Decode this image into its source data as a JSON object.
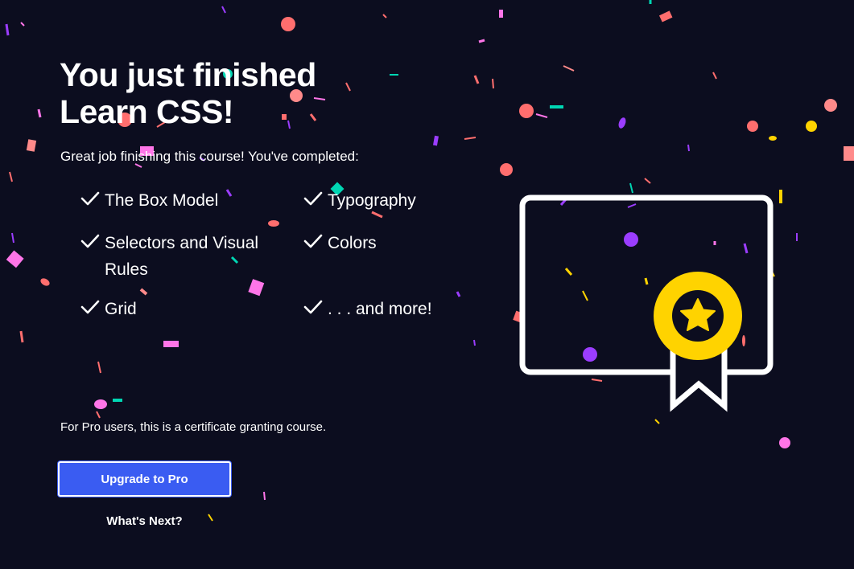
{
  "celebration": {
    "title_line1": "You just finished",
    "title_line2": "Learn CSS!",
    "subtitle": "Great job finishing this course! You've completed:",
    "completed_items": [
      {
        "label": "The Box Model"
      },
      {
        "label": "Typography"
      },
      {
        "label": "Selectors and Visual Rules"
      },
      {
        "label": "Colors"
      },
      {
        "label": "Grid"
      },
      {
        "label": ". . . and more!"
      }
    ],
    "pro_note": "For Pro users, this is a certificate granting course.",
    "upgrade_label": "Upgrade to Pro",
    "next_label": "What's Next?"
  },
  "icons": {
    "check": "check-icon",
    "certificate": "certificate-icon",
    "badge": "star-badge-icon"
  },
  "colors": {
    "background": "#0c0d1f",
    "button": "#3a5cf2",
    "badge": "#ffd300",
    "confetti": [
      "#ff6e6e",
      "#ff75e8",
      "#9b3dff",
      "#00d6b3",
      "#ffd300",
      "#ff8a8a"
    ]
  }
}
